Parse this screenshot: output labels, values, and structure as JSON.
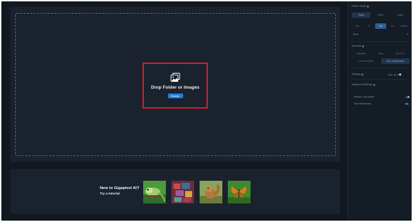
{
  "drop_zone": {
    "title": "Drop Folder or Images",
    "browse_label": "Browse"
  },
  "tutorial": {
    "title": "New to Gigapixel AI?",
    "link": "Try a tutorial",
    "thumbnails": [
      "lizard-thumbnail",
      "fabric-thumbnail",
      "squirrel-thumbnail",
      "butterfly-thumbnail"
    ]
  },
  "side_panel": {
    "resize_mode": {
      "label": "Resize Mode",
      "options": [
        "Scale",
        "Width",
        "Height"
      ],
      "selected": "Scale"
    },
    "scale_factors": {
      "options": [
        "0.5x",
        "2x",
        "4x",
        "6x",
        "Custom"
      ],
      "selected": "4x"
    },
    "dropdown_value": "None",
    "ai_model": {
      "label": "AI Model",
      "row1": [
        "Standard",
        "Lines",
        "Art & CG"
      ],
      "row2": [
        "Low Resolution",
        "Very Compressed"
      ],
      "selected": "Very Compressed"
    },
    "settings": {
      "label": "Settings",
      "auto_label": "Auto"
    },
    "additional": {
      "label": "Additional Settings",
      "items": [
        {
          "label": "Reduce Color Bleed",
          "on": true
        },
        {
          "label": "Face Refinement",
          "on": false
        }
      ]
    }
  },
  "colors": {
    "background": "#111821",
    "panel": "#1a222d",
    "highlight_box": "#d51f27",
    "accent": "#1f7fe0"
  }
}
